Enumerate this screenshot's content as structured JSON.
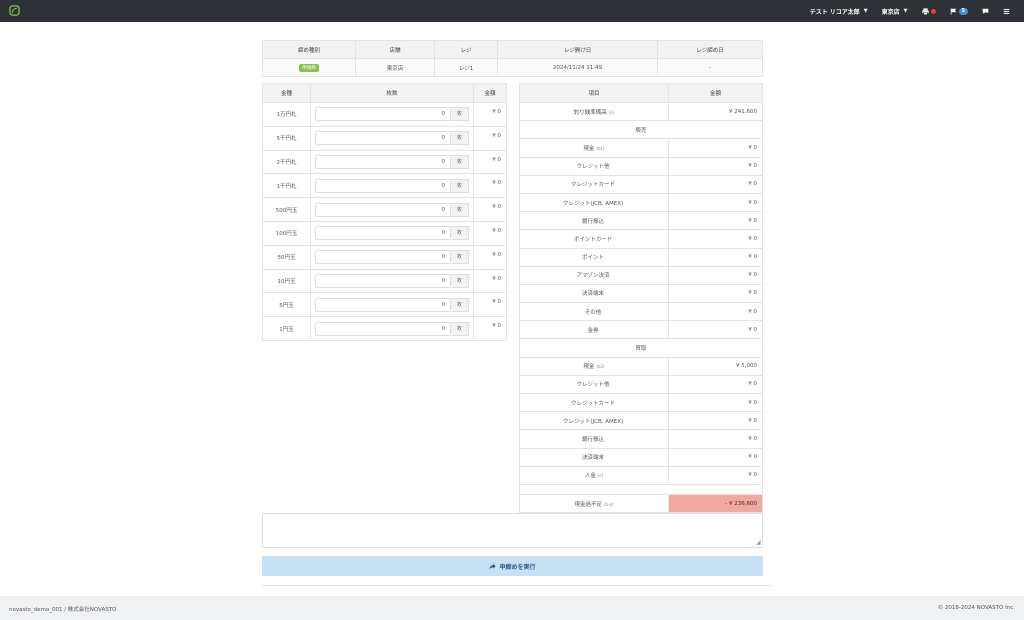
{
  "navbar": {
    "user_label": "テスト リコア太郎",
    "store_label": "東京店",
    "flag_count": "5",
    "colors": {
      "bg": "#2e3237",
      "alert": "#e84141",
      "badge": "#3d8fd6"
    }
  },
  "top_table": {
    "headers": [
      "締め種別",
      "店舗",
      "レジ",
      "レジ開け日",
      "レジ締め日"
    ],
    "status_badge": "申請締",
    "store": "東京店",
    "register": "レジ1",
    "opened": "2024/11/24 11:49",
    "closed": "-"
  },
  "cash_table": {
    "headers": [
      "金種",
      "枚数",
      "金額"
    ],
    "unit": "枚",
    "rows": [
      {
        "denom": "1万円札",
        "qty": "0",
        "amount": "¥ 0"
      },
      {
        "denom": "5千円札",
        "qty": "0",
        "amount": "¥ 0"
      },
      {
        "denom": "2千円札",
        "qty": "0",
        "amount": "¥ 0"
      },
      {
        "denom": "1千円札",
        "qty": "0",
        "amount": "¥ 0"
      },
      {
        "denom": "500円玉",
        "qty": "0",
        "amount": "¥ 0"
      },
      {
        "denom": "100円玉",
        "qty": "0",
        "amount": "¥ 0"
      },
      {
        "denom": "50円玉",
        "qty": "0",
        "amount": "¥ 0"
      },
      {
        "denom": "10円玉",
        "qty": "0",
        "amount": "¥ 0"
      },
      {
        "denom": "5円玉",
        "qty": "0",
        "amount": "¥ 0"
      },
      {
        "denom": "1円玉",
        "qty": "0",
        "amount": "¥ 0"
      }
    ]
  },
  "summary": {
    "headers": [
      "項目",
      "金額"
    ],
    "reserve": {
      "label": "釣り銭準備高",
      "suffix": "(a)",
      "value": "¥ 241,600"
    },
    "sales_title": "販売",
    "sales": [
      {
        "label": "現金",
        "suffix": "(b1)",
        "value": "¥ 0"
      },
      {
        "label": "クレジット他",
        "suffix": "",
        "value": "¥ 0"
      },
      {
        "label": "クレジットカード",
        "suffix": "",
        "value": "¥ 0"
      },
      {
        "label": "クレジット(JCB, AMEX)",
        "suffix": "",
        "value": "¥ 0"
      },
      {
        "label": "銀行振込",
        "suffix": "",
        "value": "¥ 0"
      },
      {
        "label": "ポイントカード",
        "suffix": "",
        "value": "¥ 0"
      },
      {
        "label": "ポイント",
        "suffix": "",
        "value": "¥ 0"
      },
      {
        "label": "アマゾン決済",
        "suffix": "",
        "value": "¥ 0"
      },
      {
        "label": "決済端末",
        "suffix": "",
        "value": "¥ 0"
      },
      {
        "label": "その他",
        "suffix": "",
        "value": "¥ 0"
      },
      {
        "label": "金券",
        "suffix": "",
        "value": "¥ 0"
      }
    ],
    "purchase_title": "買取",
    "purchase": [
      {
        "label": "現金",
        "suffix": "(b2)",
        "value": "¥ 5,000"
      },
      {
        "label": "クレジット他",
        "suffix": "",
        "value": "¥ 0"
      },
      {
        "label": "クレジットカード",
        "suffix": "",
        "value": "¥ 0"
      },
      {
        "label": "クレジット(JCB, AMEX)",
        "suffix": "",
        "value": "¥ 0"
      },
      {
        "label": "銀行振込",
        "suffix": "",
        "value": "¥ 0"
      },
      {
        "label": "決済端末",
        "suffix": "",
        "value": "¥ 0"
      },
      {
        "label": "入金",
        "suffix": "(c)",
        "value": "¥ 0"
      }
    ],
    "shortage": {
      "label": "現金過不足",
      "suffix": "(b-a)",
      "value": "- ¥ 236,600",
      "color": "#f2a7a0"
    }
  },
  "memo": {
    "value": ""
  },
  "actions": {
    "execute_label": "申締めを実行"
  },
  "footer": {
    "left": "novasto_demo_001 / 株式会社NOVASTO",
    "right": "© 2018-2024 NOVASTO Inc."
  }
}
